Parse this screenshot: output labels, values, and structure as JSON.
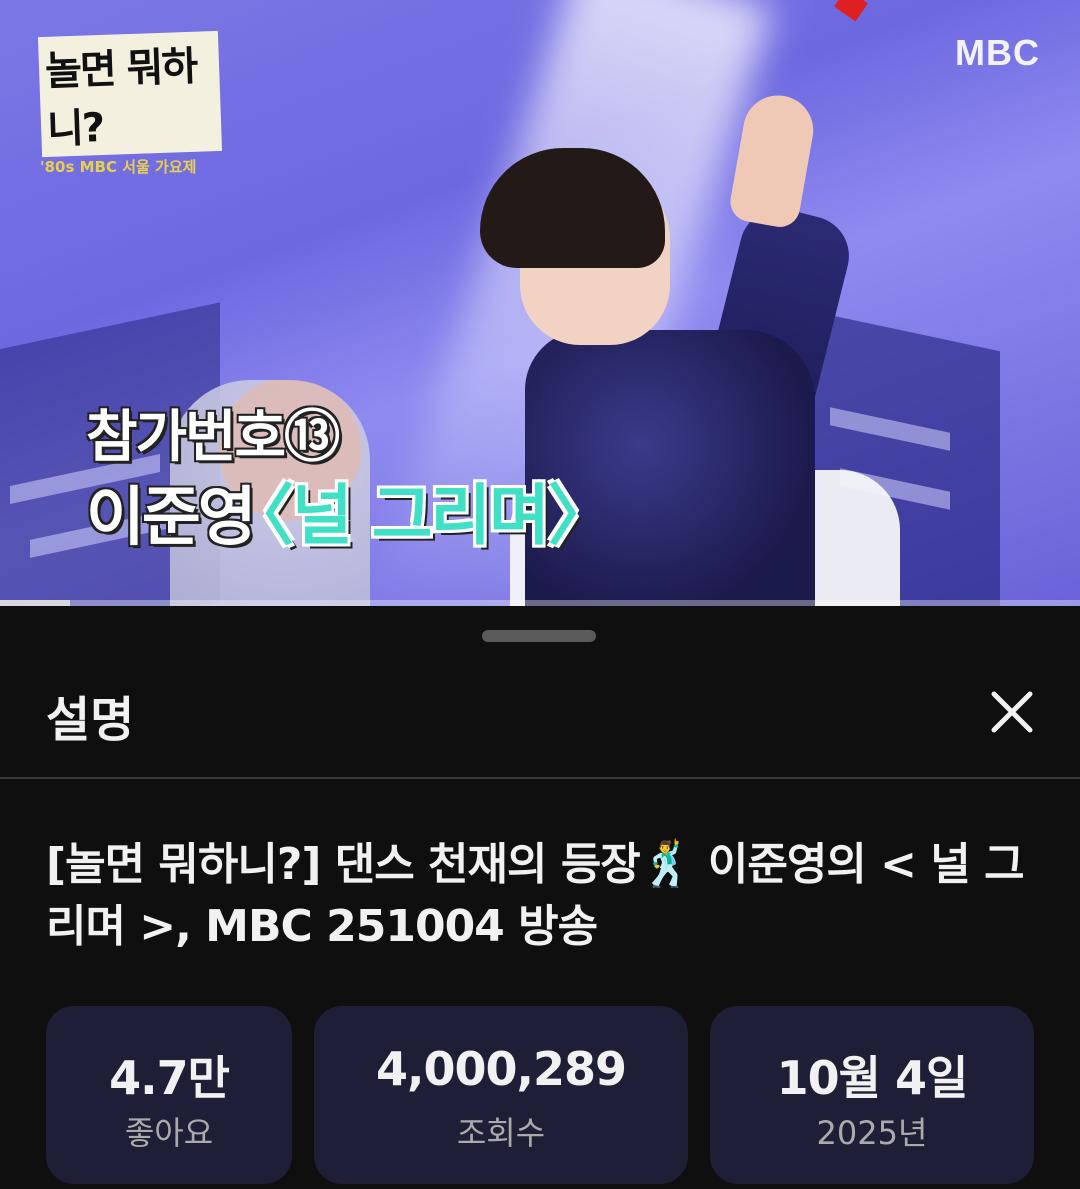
{
  "video": {
    "show_logo": "놀면 뭐하니?",
    "show_logo_sub": "'80s MBC 서울 가요제",
    "channel_logo": "MBC",
    "caption_line1": "참가번호⑬",
    "caption_name": "이준영",
    "caption_song": "〈널 그리며〉",
    "progress": 0.065
  },
  "sheet": {
    "title": "설명",
    "close_icon": "close-icon",
    "video_title": "[놀면 뭐하니?] 댄스 천재의 등장🕺 이준영의 < 널 그리며 >, MBC 251004 방송",
    "stats": [
      {
        "value": "4.7만",
        "label": "좋아요"
      },
      {
        "value": "4,000,289",
        "label": "조회수"
      },
      {
        "value": "10월 4일",
        "label": "2025년"
      }
    ]
  },
  "colors": {
    "background": "#0f0f0f",
    "stat_card": "#1e1e36",
    "caption_accent": "#3fe0c6"
  }
}
